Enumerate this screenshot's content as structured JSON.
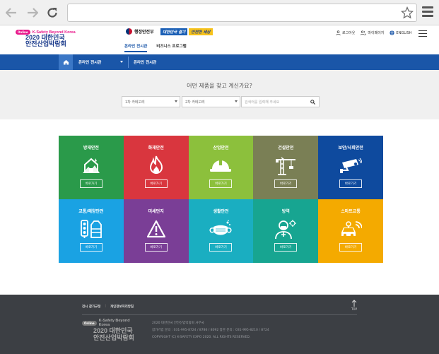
{
  "browser": {
    "url": ""
  },
  "logo": {
    "badge": "Online",
    "subtitle": "K-Safety Beyond Korea",
    "line1": "2020 대한민국",
    "line2": "안전산업박람회"
  },
  "header": {
    "ministry": "행정안전부",
    "slogan_part1": "대한민국 결기",
    "slogan_part2": "안전한 세상",
    "nav": [
      {
        "label": "온라인 전시관"
      },
      {
        "label": "비즈니스 프로그램"
      }
    ],
    "util": {
      "logout": "로그아웃",
      "mypage": "마이페이지",
      "english": "ENGLISH"
    }
  },
  "subnav": {
    "item1": "온라인 전시관",
    "item2": "온라인 전시관"
  },
  "search": {
    "title": "어떤 제품을 찾고 계신가요?",
    "select1": "1차 카테고리",
    "select2": "2차 카테고리",
    "placeholder": "검색어를 입력해 주세요"
  },
  "categories": [
    {
      "title": "방재안전",
      "button": "바로가기",
      "color": "#2a9a4a",
      "icon": "house-damage-icon"
    },
    {
      "title": "화재안전",
      "button": "바로가기",
      "color": "#d9363e",
      "icon": "fire-icon"
    },
    {
      "title": "산업안전",
      "button": "바로가기",
      "color": "#8cc03c",
      "icon": "hardhat-icon"
    },
    {
      "title": "건설안전",
      "button": "바로가기",
      "color": "#7a7f55",
      "icon": "crane-icon"
    },
    {
      "title": "보안/사회안전",
      "button": "바로가기",
      "color": "#0e4a9e",
      "icon": "cctv-icon"
    },
    {
      "title": "교통/해양안전",
      "button": "바로가기",
      "color": "#1aa2e3",
      "icon": "traffic-light-icon"
    },
    {
      "title": "미세먼지",
      "button": "바로가기",
      "color": "#7a3e96",
      "icon": "warning-icon"
    },
    {
      "title": "생활안전",
      "button": "바로가기",
      "color": "#1aaec1",
      "icon": "mask-icon"
    },
    {
      "title": "방역",
      "button": "바로가기",
      "color": "#17a591",
      "icon": "doctor-icon"
    },
    {
      "title": "스마트교통",
      "button": "바로가기",
      "color": "#f4aa00",
      "icon": "smart-car-icon"
    }
  ],
  "footer": {
    "link1": "전시 참가규정",
    "link2": "개인정보처리방침",
    "top": "TOP",
    "info1": "2020 대한민국 안전산업박람회 사무국",
    "info2": "참가기업 문의 : 031-995-8724 / 8786 / 8092    참관 문의 : 031-995-8210 / 8724",
    "copyright": "COPYRIGHT (C) K-SAFETY EXPO 2020. ALL RIGHTS RESERVED."
  }
}
